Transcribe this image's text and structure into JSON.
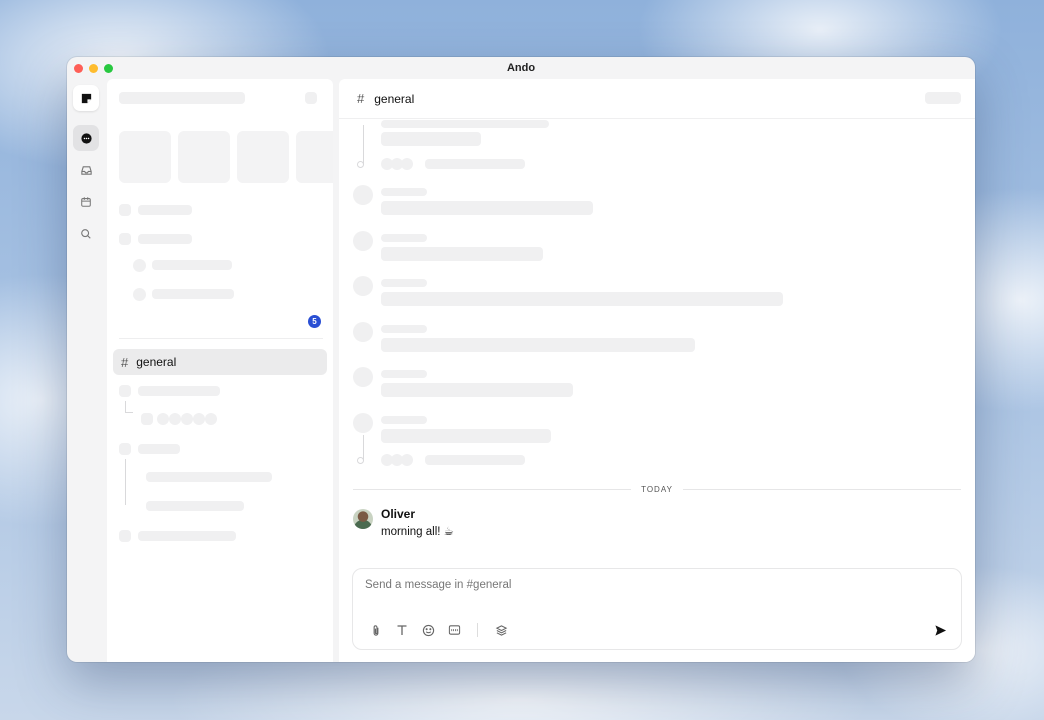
{
  "window": {
    "title": "Ando"
  },
  "rail": {
    "items": [
      "logo",
      "messages",
      "inbox",
      "calendar",
      "search"
    ]
  },
  "sidebar": {
    "unread_badge": "5",
    "active_channel": {
      "name": "general"
    }
  },
  "main": {
    "channel_name": "general",
    "day_divider": "TODAY",
    "message": {
      "author": "Oliver",
      "text": "morning all! ☕"
    },
    "composer": {
      "placeholder": "Send a message in #general"
    }
  }
}
